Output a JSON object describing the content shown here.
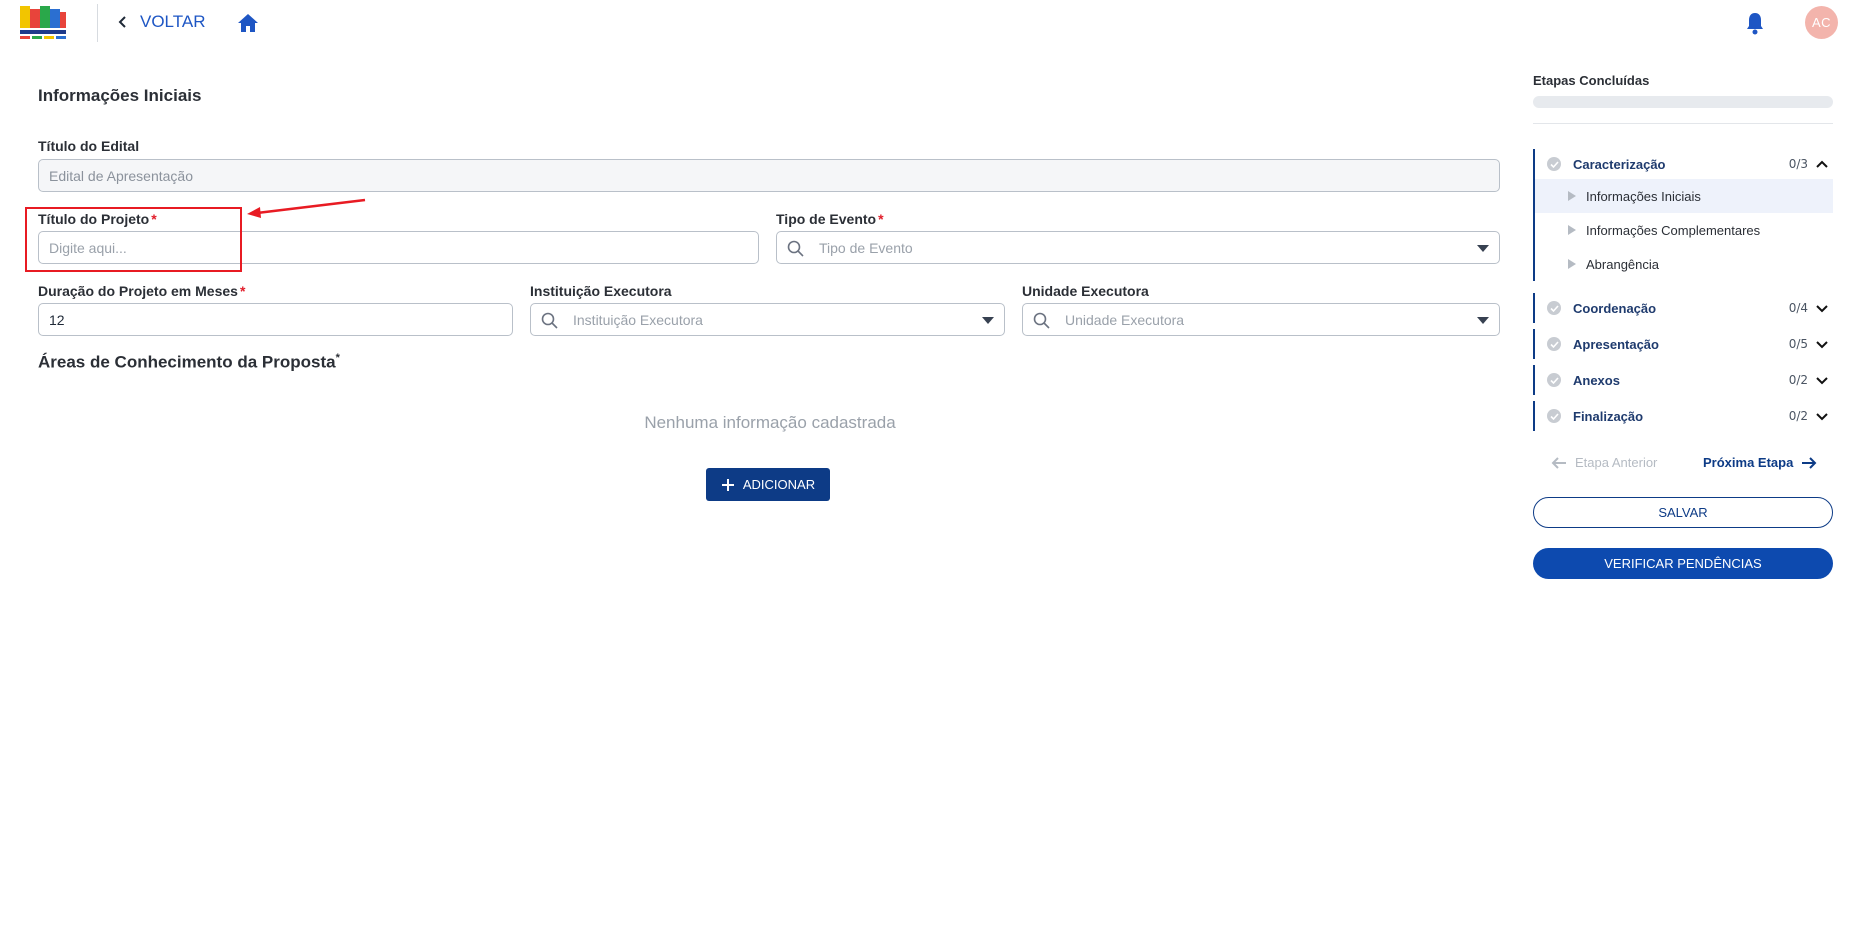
{
  "header": {
    "back_label": "VOLTAR",
    "avatar_initials": "AC"
  },
  "form": {
    "section_title": "Informações Iniciais",
    "titulo_edital": {
      "label": "Título do Edital",
      "value": "Edital de Apresentação"
    },
    "titulo_projeto": {
      "label": "Título do Projeto",
      "required": "*",
      "placeholder": "Digite aqui..."
    },
    "tipo_evento": {
      "label": "Tipo de Evento",
      "required": "*",
      "placeholder": "Tipo de Evento"
    },
    "duracao": {
      "label": "Duração do Projeto em Meses",
      "required": "*",
      "value": "12"
    },
    "instituicao": {
      "label": "Instituição Executora",
      "placeholder": "Instituição Executora"
    },
    "unidade": {
      "label": "Unidade Executora",
      "placeholder": "Unidade Executora"
    },
    "areas_title": "Áreas de Conhecimento da Proposta",
    "areas_required": "*",
    "empty_message": "Nenhuma informação cadastrada",
    "add_label": "ADICIONAR"
  },
  "sidebar": {
    "title": "Etapas Concluídas",
    "progress": 0,
    "steps": [
      {
        "label": "Caracterização",
        "count": "0/3",
        "expanded": true,
        "subitems": [
          "Informações Iniciais",
          "Informações Complementares",
          "Abrangência"
        ]
      },
      {
        "label": "Coordenação",
        "count": "0/4",
        "expanded": false
      },
      {
        "label": "Apresentação",
        "count": "0/5",
        "expanded": false
      },
      {
        "label": "Anexos",
        "count": "0/2",
        "expanded": false
      },
      {
        "label": "Finalização",
        "count": "0/2",
        "expanded": false
      }
    ],
    "prev_label": "Etapa Anterior",
    "next_label": "Próxima Etapa",
    "save_label": "SALVAR",
    "verify_label": "VERIFICAR PENDÊNCIAS"
  },
  "colors": {
    "primary": "#0d3b86",
    "accent": "#1e56c4",
    "required": "#e11d2a",
    "highlight": "#e81b23"
  }
}
